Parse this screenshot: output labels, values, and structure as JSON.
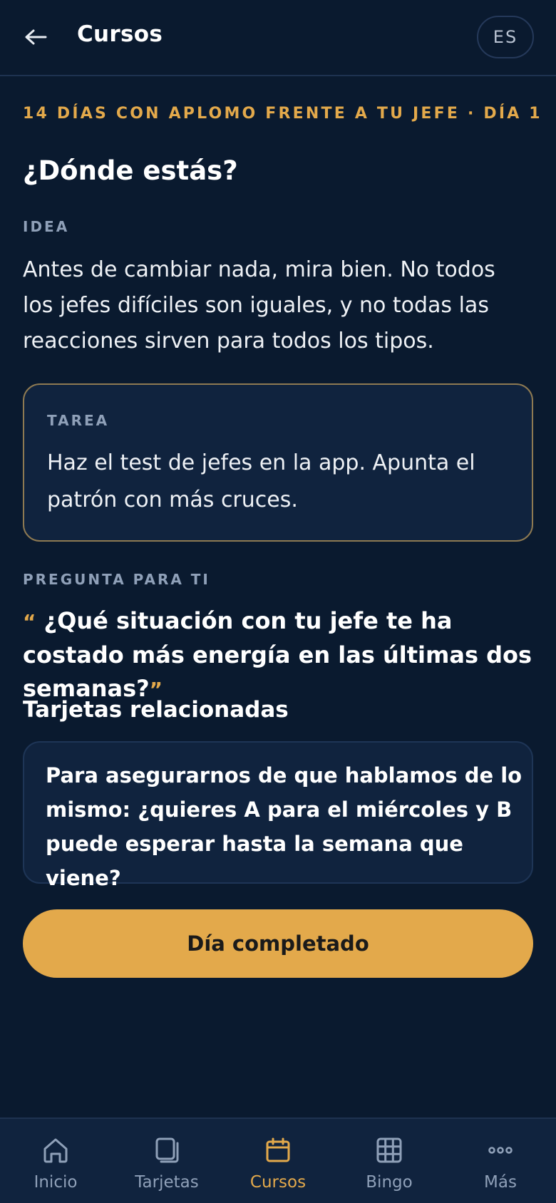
{
  "header": {
    "title": "Cursos",
    "language": "ES"
  },
  "lesson": {
    "kicker": "14 DÍAS CON APLOMO FRENTE A TU JEFE · DÍA 1",
    "title": "¿Dónde estás?",
    "idea_label": "IDEA",
    "idea_text": "Antes de cambiar nada, mira bien. No todos los jefes difíciles son iguales, y no todas las reacciones sirven para todos los tipos.",
    "task_label": "TAREA",
    "task_text": "Haz el test de jefes en la app. Apunta el patrón con más cruces.",
    "question_label": "PREGUNTA PARA TI",
    "question_open": "“",
    "question_text": "¿Qué situación con tu jefe te ha costado más energía en las últimas dos semanas?",
    "question_close": "”",
    "related_title": "Tarjetas relacionadas",
    "related_card_text": "Para asegurarnos de que hablamos de lo mismo: ¿quieres A para el miércoles y B puede esperar hasta la semana que viene?",
    "complete_button": "Día completado"
  },
  "nav": {
    "items": [
      {
        "label": "Inicio",
        "icon": "home-icon"
      },
      {
        "label": "Tarjetas",
        "icon": "cards-icon"
      },
      {
        "label": "Cursos",
        "icon": "calendar-icon",
        "active": true
      },
      {
        "label": "Bingo",
        "icon": "grid-icon"
      },
      {
        "label": "Más",
        "icon": "more-icon"
      }
    ]
  },
  "colors": {
    "background": "#0a1a2f",
    "card": "#10233e",
    "accent": "#e3a94b",
    "muted": "#8fa0b8"
  }
}
